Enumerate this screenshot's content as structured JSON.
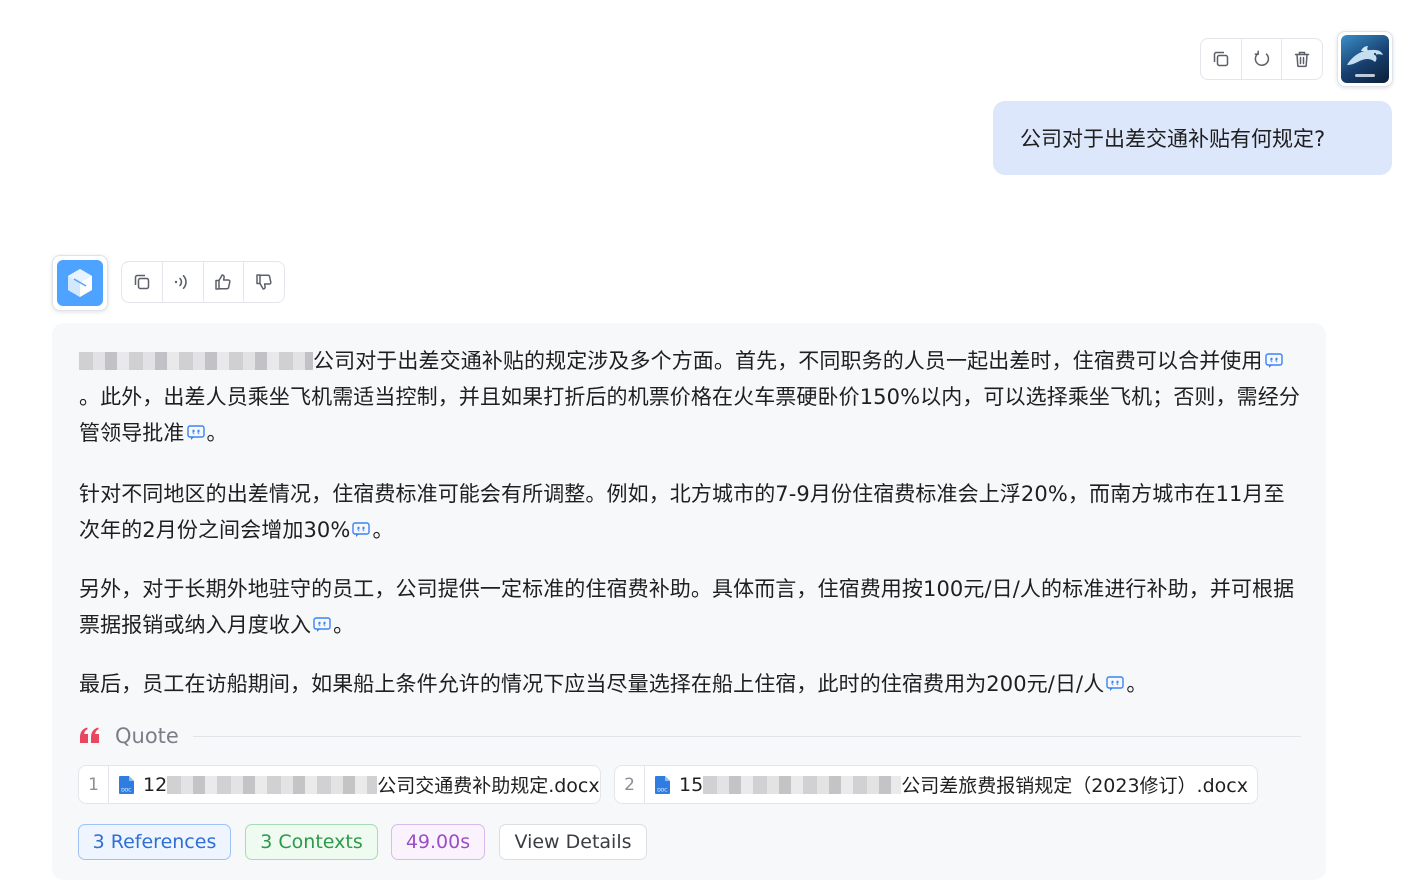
{
  "user_message": {
    "text": "公司对于出差交通补贴有何规定?",
    "actions": [
      "copy-icon",
      "regenerate-icon",
      "delete-icon"
    ]
  },
  "assistant": {
    "actions": [
      "copy-icon",
      "speaker-icon",
      "thumbs-up-icon",
      "thumbs-down-icon"
    ],
    "paragraphs": {
      "p1a": "公司对于出差交通补贴的规定涉及多个方面。首先，不同职务的人员一起出差时，住宿费可以合并使用",
      "p1b": "。此外，出差人员乘坐飞机需适当控制，并且如果打折后的机票价格在火车票硬卧价150%以内，可以选择乘坐飞机；否则，需经分管领导批准",
      "p1c": "。",
      "p2a": "针对不同地区的出差情况，住宿费标准可能会有所调整。例如，北方城市的7-9月份住宿费标准会上浮20%，而南方城市在11月至次年的2月份之间会增加30%",
      "p2b": "。",
      "p3a": "另外，对于长期外地驻守的员工，公司提供一定标准的住宿费补助。具体而言，住宿费用按100元/日/人的标准进行补助，并可根据票据报销或纳入月度收入",
      "p3b": "。",
      "p4a": "最后，员工在访船期间，如果船上条件允许的情况下应当尽量选择在船上住宿，此时的住宿费用为200元/日/人",
      "p4b": "。"
    },
    "quote": {
      "label": "Quote",
      "refs": [
        {
          "num": "1",
          "prefix": "12",
          "suffix": "公司交通费补助规定.docx"
        },
        {
          "num": "2",
          "prefix": "15",
          "suffix": "公司差旅费报销规定（2023修订）.docx"
        }
      ]
    },
    "tags": {
      "references": "3 References",
      "contexts": "3 Contexts",
      "time": "49.00s",
      "view_details": "View Details"
    }
  },
  "colors": {
    "user_bubble": "#dde7fb",
    "card_bg": "#f7f8fa",
    "accent_blue": "#2f6ed6",
    "accent_green": "#2c9a4a",
    "accent_purple": "#9b4fc6",
    "quote_mark": "#e8475f"
  }
}
